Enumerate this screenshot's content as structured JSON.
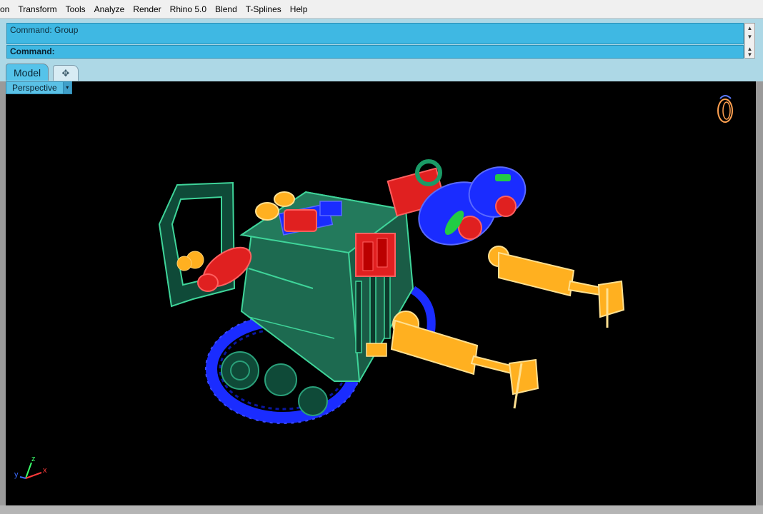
{
  "menubar": {
    "items": [
      "on",
      "Transform",
      "Tools",
      "Analyze",
      "Render",
      "Rhino 5.0",
      "Blend",
      "T-Splines",
      "Help"
    ]
  },
  "command": {
    "history": "Command: Group",
    "prompt": "Command:"
  },
  "tabs": {
    "model_label": "Model",
    "add_label": "✥"
  },
  "viewport": {
    "label": "Perspective",
    "dropdown_icon": "▾",
    "background": "#000000",
    "axes": {
      "x": "x",
      "y": "y",
      "z": "z"
    }
  },
  "icons": {
    "scroll_up": "chevron-up-icon",
    "scroll_down": "chevron-down-icon",
    "add_tab": "plus-icon",
    "gumball": "navigation-gumball-icon"
  },
  "colors": {
    "command_bg": "#3fb8e3",
    "panel_bg": "#add8e6",
    "tab_active": "#55c3ea",
    "green_body": "#1d6a50",
    "red_parts": "#e02020",
    "blue_tracks": "#1a2cff",
    "yellow_arms": "#ffb020"
  }
}
